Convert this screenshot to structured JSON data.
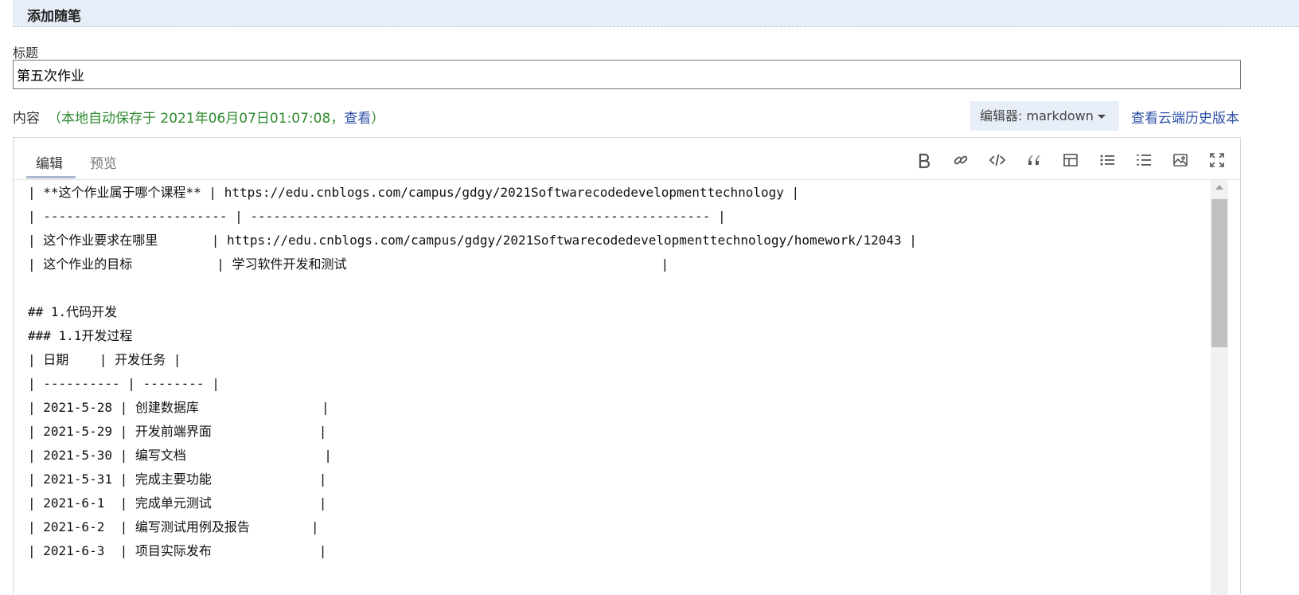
{
  "header": {
    "title": "添加随笔"
  },
  "title_field": {
    "label": "标题",
    "value": "第五次作业"
  },
  "content": {
    "label": "内容",
    "autosave_prefix": "（本地自动保存于 2021年06月07日01:07:08，",
    "view_link": "查看",
    "autosave_suffix": "）",
    "editor_select": "编辑器: markdown",
    "history_link": "查看云端历史版本"
  },
  "editor": {
    "tabs": [
      "编辑",
      "预览"
    ],
    "active_tab": "编辑",
    "toolbar_icons": [
      "bold-icon",
      "link-icon",
      "code-icon",
      "quote-icon",
      "table-icon",
      "unordered-list-icon",
      "ordered-list-icon",
      "image-icon",
      "fullscreen-icon"
    ],
    "lines": [
      "| **这个作业属于哪个课程** | https://edu.cnblogs.com/campus/gdgy/2021Softwarecodedevelopmenttechnology |",
      "| ------------------------ | ------------------------------------------------------------ |",
      "| 这个作业要求在哪里       | https://edu.cnblogs.com/campus/gdgy/2021Softwarecodedevelopmenttechnology/homework/12043 |",
      "| 这个作业的目标           | 学习软件开发和测试                                         |",
      "",
      "## 1.代码开发",
      "### 1.1开发过程",
      "| 日期    | 开发任务 |",
      "| ---------- | -------- |",
      "| 2021-5-28 | 创建数据库                |",
      "| 2021-5-29 | 开发前端界面              |",
      "| 2021-5-30 | 编写文档                  |",
      "| 2021-5-31 | 完成主要功能              |",
      "| 2021-6-1  | 完成单元测试              |",
      "| 2021-6-2  | 编写测试用例及报告        |",
      "| 2021-6-3  | 项目实际发布              |"
    ]
  }
}
